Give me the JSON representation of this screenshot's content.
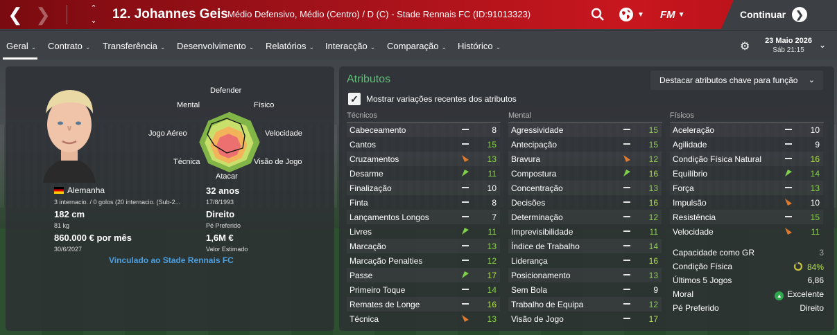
{
  "header": {
    "player_name": "12. Johannes Geis",
    "description": "Médio Defensivo, Médio (Centro) / D (C) - Stade Rennais FC (ID:91013323)",
    "continue_label": "Continuar",
    "fm_label": "FM"
  },
  "menu": {
    "tabs": [
      {
        "label": "Geral",
        "active": true
      },
      {
        "label": "Contrato"
      },
      {
        "label": "Transferência"
      },
      {
        "label": "Desenvolvimento"
      },
      {
        "label": "Relatórios"
      },
      {
        "label": "Interacção"
      },
      {
        "label": "Comparação"
      },
      {
        "label": "Histórico"
      }
    ],
    "date": "23 Maio 2026",
    "time": "Sáb 21:15"
  },
  "profile": {
    "radar_labels": {
      "top": "Defender",
      "top_left": "Mental",
      "top_right": "Físico",
      "left": "Jogo Aéreo",
      "right": "Velocidade",
      "bottom_left": "Técnica",
      "bottom_right": "Visão de Jogo",
      "bottom": "Atacar"
    },
    "nationality": "Alemanha",
    "caps": "3 internacio. / 0 golos (20 internacio. (Sub-2...",
    "age": "32 anos",
    "birth_date": "17/8/1993",
    "height": "182 cm",
    "weight": "81 kg",
    "preferred_foot": "Direito",
    "preferred_foot_label": "Pé Preferido",
    "wage": "860.000 € por mês",
    "contract_end": "30/6/2027",
    "value": "1,6M €",
    "value_label": "Valor Estimado",
    "club_link": "Vinculado ao Stade Rennais FC"
  },
  "attributes": {
    "title": "Atributos",
    "highlight_button": "Destacar atributos chave para função",
    "show_changes_label": "Mostrar variações recentes dos atributos",
    "columns": [
      {
        "header": "Técnicos",
        "rows": [
          {
            "name": "Cabeceamento",
            "change": "none",
            "value": "8"
          },
          {
            "name": "Cantos",
            "change": "none",
            "value": "15"
          },
          {
            "name": "Cruzamentos",
            "change": "down",
            "value": "13"
          },
          {
            "name": "Desarme",
            "change": "up",
            "value": "11"
          },
          {
            "name": "Finalização",
            "change": "none",
            "value": "10"
          },
          {
            "name": "Finta",
            "change": "none",
            "value": "8"
          },
          {
            "name": "Lançamentos Longos",
            "change": "none",
            "value": "7"
          },
          {
            "name": "Livres",
            "change": "up",
            "value": "11"
          },
          {
            "name": "Marcação",
            "change": "none",
            "value": "13"
          },
          {
            "name": "Marcação Penalties",
            "change": "none",
            "value": "12"
          },
          {
            "name": "Passe",
            "change": "up",
            "value": "17"
          },
          {
            "name": "Primeiro Toque",
            "change": "none",
            "value": "14"
          },
          {
            "name": "Remates de Longe",
            "change": "none",
            "value": "16"
          },
          {
            "name": "Técnica",
            "change": "down",
            "value": "13"
          }
        ]
      },
      {
        "header": "Mental",
        "rows": [
          {
            "name": "Agressividade",
            "change": "none",
            "value": "15"
          },
          {
            "name": "Antecipação",
            "change": "none",
            "value": "15"
          },
          {
            "name": "Bravura",
            "change": "down",
            "value": "12"
          },
          {
            "name": "Compostura",
            "change": "up",
            "value": "16"
          },
          {
            "name": "Concentração",
            "change": "none",
            "value": "13"
          },
          {
            "name": "Decisões",
            "change": "none",
            "value": "16"
          },
          {
            "name": "Determinação",
            "change": "none",
            "value": "12"
          },
          {
            "name": "Imprevisibilidade",
            "change": "none",
            "value": "11"
          },
          {
            "name": "Índice de Trabalho",
            "change": "none",
            "value": "14"
          },
          {
            "name": "Liderança",
            "change": "none",
            "value": "16"
          },
          {
            "name": "Posicionamento",
            "change": "none",
            "value": "13"
          },
          {
            "name": "Sem Bola",
            "change": "none",
            "value": "9"
          },
          {
            "name": "Trabalho de Equipa",
            "change": "none",
            "value": "12"
          },
          {
            "name": "Visão de Jogo",
            "change": "none",
            "value": "17"
          }
        ]
      },
      {
        "header": "Físicos",
        "rows": [
          {
            "name": "Aceleração",
            "change": "none",
            "value": "10"
          },
          {
            "name": "Agilidade",
            "change": "none",
            "value": "9"
          },
          {
            "name": "Condição Física Natural",
            "change": "none",
            "value": "16"
          },
          {
            "name": "Equilíbrio",
            "change": "up",
            "value": "14"
          },
          {
            "name": "Força",
            "change": "none",
            "value": "13"
          },
          {
            "name": "Impulsão",
            "change": "down",
            "value": "10"
          },
          {
            "name": "Resistência",
            "change": "none",
            "value": "15"
          },
          {
            "name": "Velocidade",
            "change": "down",
            "value": "11"
          }
        ]
      }
    ]
  },
  "stats": [
    {
      "label": "Capacidade como GR",
      "value": "3"
    },
    {
      "label": "Condição Física",
      "value": "84%",
      "icon": "fitness-ring-icon"
    },
    {
      "label": "Últimos 5 Jogos",
      "value": "6,86"
    },
    {
      "label": "Moral",
      "value": "Excelente",
      "icon": "morale-up-icon"
    },
    {
      "label": "Pé Preferido",
      "value": "Direito"
    }
  ],
  "colors": {
    "header_red": "#c8161e",
    "attribute_title_green": "#5fbf7a",
    "value_green": "#8ad24a",
    "arrow_up": "#7fd04a",
    "arrow_down": "#e07a2e",
    "link_blue": "#4a9fe0"
  }
}
